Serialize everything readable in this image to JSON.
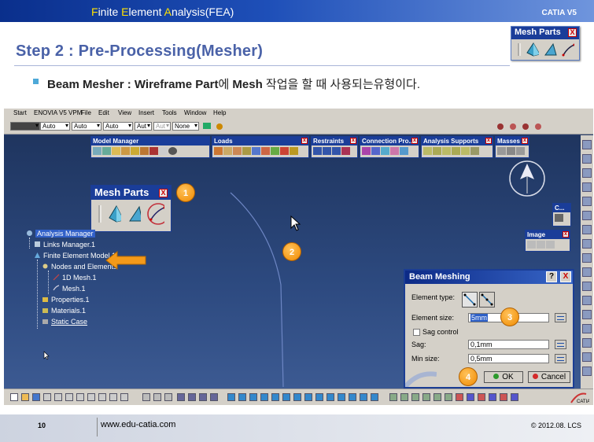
{
  "slide": {
    "header_title_parts": [
      "F",
      "inite ",
      "E",
      "lement ",
      "A",
      "nalysis(FEA)"
    ],
    "header_brand": "CATIA V5",
    "step_title": "Step 2 : Pre-Processing(Mesher)",
    "bullet_bold": "Beam Mesher : Wireframe Part",
    "bullet_mid": "에 ",
    "bullet_bold2": "Mesh",
    "bullet_rest": " 작업을 할 때 사용되는유형이다.",
    "page_number": "10",
    "footer_url": "www.edu-catia.com",
    "footer_copyright": "© 2012.08. LCS"
  },
  "corner_toolbar": {
    "title": "Mesh Parts",
    "close": "X"
  },
  "menubar": {
    "items": [
      "Start",
      "ENOVIA V5 VPM",
      "File",
      "Edit",
      "View",
      "Insert",
      "Tools",
      "Window",
      "Help"
    ]
  },
  "properties_bar": {
    "combos": [
      "",
      "Auto",
      "Auto",
      "Auto",
      "Aut",
      "Aut",
      "None"
    ]
  },
  "toolbars": [
    {
      "title": "Model Manager"
    },
    {
      "title": "Loads"
    },
    {
      "title": "Restraints"
    },
    {
      "title": "Connection Pro..."
    },
    {
      "title": "Analysis Supports"
    },
    {
      "title": "Masses"
    },
    {
      "title": "C..."
    },
    {
      "title": "Image"
    }
  ],
  "mesh_parts_toolbar": {
    "title": "Mesh Parts",
    "close": "X"
  },
  "tree": {
    "root": "Analysis Manager",
    "links": "Links Manager.1",
    "model": "Finite Element Model.1",
    "nodes": "Nodes and Elements",
    "mesh1d": "1D Mesh.1",
    "mesh": "Mesh.1",
    "properties": "Properties.1",
    "materials": "Materials.1",
    "static": "Static Case"
  },
  "beam_dialog": {
    "title": "Beam Meshing",
    "help": "?",
    "close": "X",
    "element_type_label": "Element type:",
    "element_size_label": "Element size:",
    "element_size_value": "5mm",
    "sag_control_label": "Sag control",
    "sag_label": "Sag:",
    "sag_value": "0,1mm",
    "min_size_label": "Min size:",
    "min_size_value": "0,5mm",
    "ok_label": "OK",
    "cancel_label": "Cancel"
  },
  "callouts": [
    "1",
    "2",
    "3",
    "4"
  ],
  "colors": {
    "header_bar": "#0a2f8c",
    "title_blue": "#4a62a8",
    "callout": "#f08a00",
    "accent_yellow": "#ffe100"
  }
}
